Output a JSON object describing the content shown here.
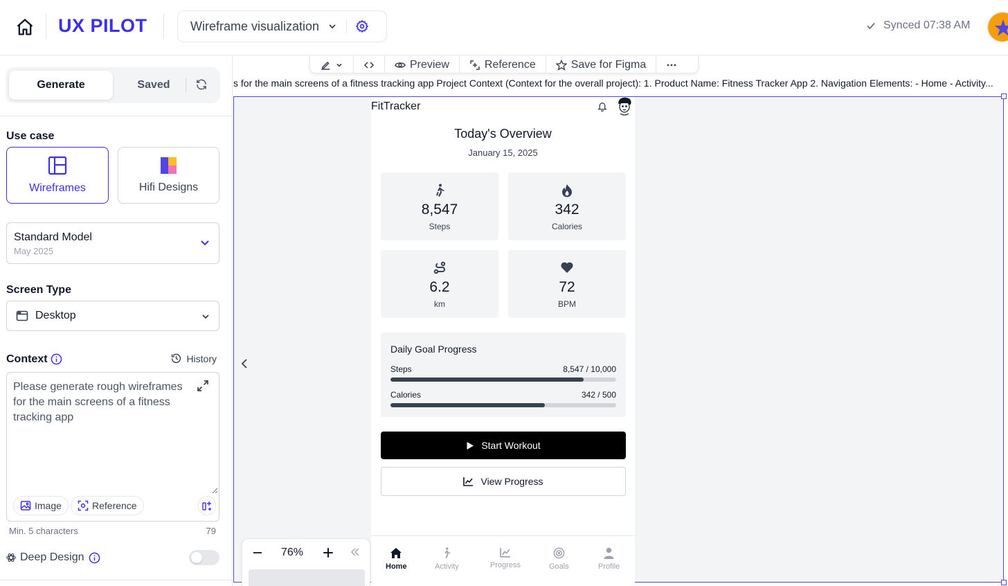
{
  "app": {
    "logo": "UX PILOT",
    "project_title": "Wireframe visualization",
    "sync_status": "Synced 07:38 AM"
  },
  "sidebar": {
    "tabs": {
      "generate": "Generate",
      "saved": "Saved"
    },
    "use_case": {
      "label": "Use case",
      "options": [
        {
          "label": "Wireframes",
          "selected": true
        },
        {
          "label": "Hifi Designs",
          "selected": false
        }
      ]
    },
    "model": {
      "name": "Standard Model",
      "version": "May 2025"
    },
    "screen_type": {
      "label": "Screen Type",
      "value": "Desktop"
    },
    "context": {
      "label": "Context",
      "history_label": "History",
      "text": "Please generate rough wireframes for the main screens of a fitness tracking app",
      "image_chip": "Image",
      "reference_chip": "Reference",
      "min_chars": "Min. 5 characters",
      "char_count": "79"
    },
    "deep_design": {
      "label": "Deep Design",
      "enabled": false
    }
  },
  "canvas": {
    "toolbar": {
      "preview": "Preview",
      "reference": "Reference",
      "save": "Save for Figma"
    },
    "prompt_strip": "s for the main screens of a fitness tracking app Project Context (Context for the overall project): 1. Product Name: Fitness Tracker App 2. Navigation Elements: - Home - Activity...",
    "zoom": "76%"
  },
  "phone": {
    "brand": "FitTracker",
    "title": "Today's Overview",
    "date": "January 15, 2025",
    "stats": [
      {
        "value": "8,547",
        "label": "Steps",
        "icon": "walking-icon"
      },
      {
        "value": "342",
        "label": "Calories",
        "icon": "flame-icon"
      },
      {
        "value": "6.2",
        "label": "km",
        "icon": "route-icon"
      },
      {
        "value": "72",
        "label": "BPM",
        "icon": "heart-icon"
      }
    ],
    "goal": {
      "title": "Daily Goal Progress",
      "rows": [
        {
          "label": "Steps",
          "value_text": "8,547 / 10,000",
          "fraction": 0.8547
        },
        {
          "label": "Calories",
          "value_text": "342 / 500",
          "fraction": 0.684
        }
      ]
    },
    "buttons": {
      "start": "Start Workout",
      "view": "View Progress"
    },
    "nav": [
      {
        "label": "Home",
        "active": true
      },
      {
        "label": "Activity",
        "active": false
      },
      {
        "label": "Progress",
        "active": false
      },
      {
        "label": "Goals",
        "active": false
      },
      {
        "label": "Profile",
        "active": false
      }
    ]
  },
  "colors": {
    "accent": "#3b30e8",
    "frame": "#4f46e5"
  }
}
